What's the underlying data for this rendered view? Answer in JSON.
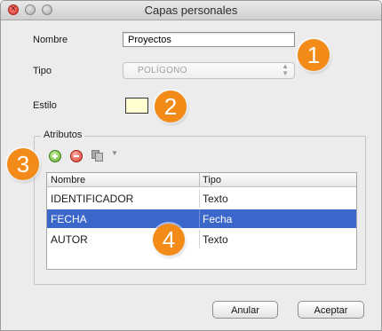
{
  "window": {
    "title": "Capas personales"
  },
  "form": {
    "nombre_label": "Nombre",
    "nombre_value": "Proyectos",
    "tipo_label": "Tipo",
    "tipo_value": "POLÍGONO",
    "estilo_label": "Estilo",
    "estilo_color": "#ffffd2"
  },
  "atributos": {
    "group_title": "Atributos",
    "columns": [
      "Nombre",
      "Tipo"
    ],
    "rows": [
      {
        "nombre": "IDENTIFICADOR",
        "tipo": "Texto",
        "selected": false
      },
      {
        "nombre": "FECHA",
        "tipo": "Fecha",
        "selected": true
      },
      {
        "nombre": "AUTOR",
        "tipo": "Texto",
        "selected": false
      }
    ]
  },
  "callouts": [
    "1",
    "2",
    "3",
    "4"
  ],
  "buttons": {
    "cancel": "Anular",
    "ok": "Aceptar"
  },
  "colors": {
    "accent_callout": "#f28b17",
    "selection": "#3a67c9"
  }
}
